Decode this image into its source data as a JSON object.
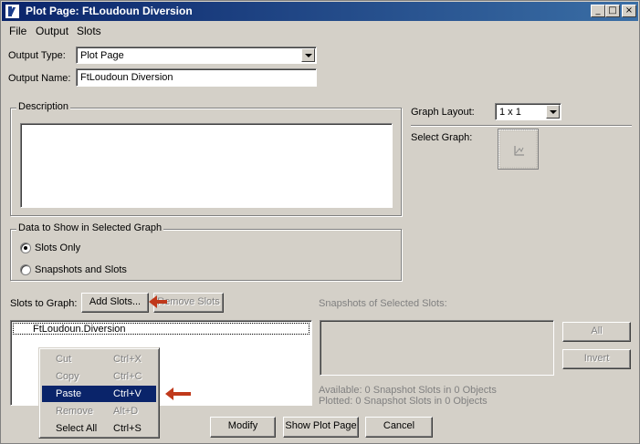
{
  "window": {
    "title": "Plot Page: FtLoudoun Diversion"
  },
  "menu": [
    "File",
    "Output",
    "Slots"
  ],
  "form": {
    "output_type_label": "Output Type:",
    "output_type_value": "Plot Page",
    "output_name_label": "Output Name:",
    "output_name_value": "FtLoudoun Diversion",
    "description_label": "Description",
    "description_value": ""
  },
  "graph": {
    "layout_label": "Graph Layout:",
    "layout_value": "1 x 1",
    "select_label": "Select Graph:"
  },
  "data_group": {
    "title": "Data to Show in Selected Graph",
    "options": [
      "Slots Only",
      "Snapshots and Slots"
    ],
    "selected": "Slots Only"
  },
  "slots": {
    "label": "Slots to Graph:",
    "add_button": "Add Slots...",
    "remove_button": "Remove Slots",
    "items": [
      "FtLoudoun.Diversion"
    ]
  },
  "snapshots": {
    "label": "Snapshots of Selected Slots:",
    "all_button": "All",
    "invert_button": "Invert",
    "available": "Available:  0 Snapshot Slots in 0 Objects",
    "plotted": "Plotted:  0 Snapshot Slots in 0 Objects"
  },
  "context_menu": [
    {
      "label": "Cut",
      "shortcut": "Ctrl+X"
    },
    {
      "label": "Copy",
      "shortcut": "Ctrl+C"
    },
    {
      "label": "Paste",
      "shortcut": "Ctrl+V"
    },
    {
      "label": "Remove",
      "shortcut": "Alt+D"
    },
    {
      "label": "Select All",
      "shortcut": "Ctrl+S"
    }
  ],
  "bottom_buttons": {
    "modify": "Modify",
    "show": "Show Plot Page",
    "cancel": "Cancel"
  },
  "colors": {
    "titlebar": "#0a246a",
    "highlight": "#0a246a",
    "annotation_arrow": "#c0391b"
  }
}
